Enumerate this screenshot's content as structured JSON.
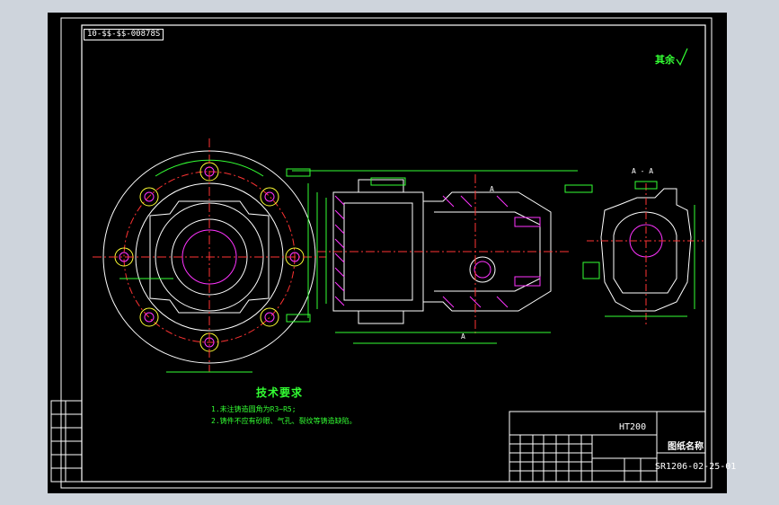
{
  "drawing": {
    "code_tag": "10-$$-$$-00878S",
    "roughness_note": "其余",
    "section_label": "A - A",
    "section_mark": "A",
    "technical_requirements": {
      "title": "技术要求",
      "items": [
        "1.未注铸造圆角为R3~R5;",
        "2.铸件不应有砂眼、气孔、裂纹等铸造缺陷。"
      ]
    },
    "title_block": {
      "material": "HT200",
      "drawing_name": "图纸名称",
      "drawing_number": "SR1206-02-25-01"
    }
  },
  "colors": {
    "background": "#000000",
    "outline": "#ffffff",
    "dimension": "#33ff33",
    "center_line": "#ff3333",
    "hatch": "#ff33ff",
    "hidden": "#ffff33"
  }
}
